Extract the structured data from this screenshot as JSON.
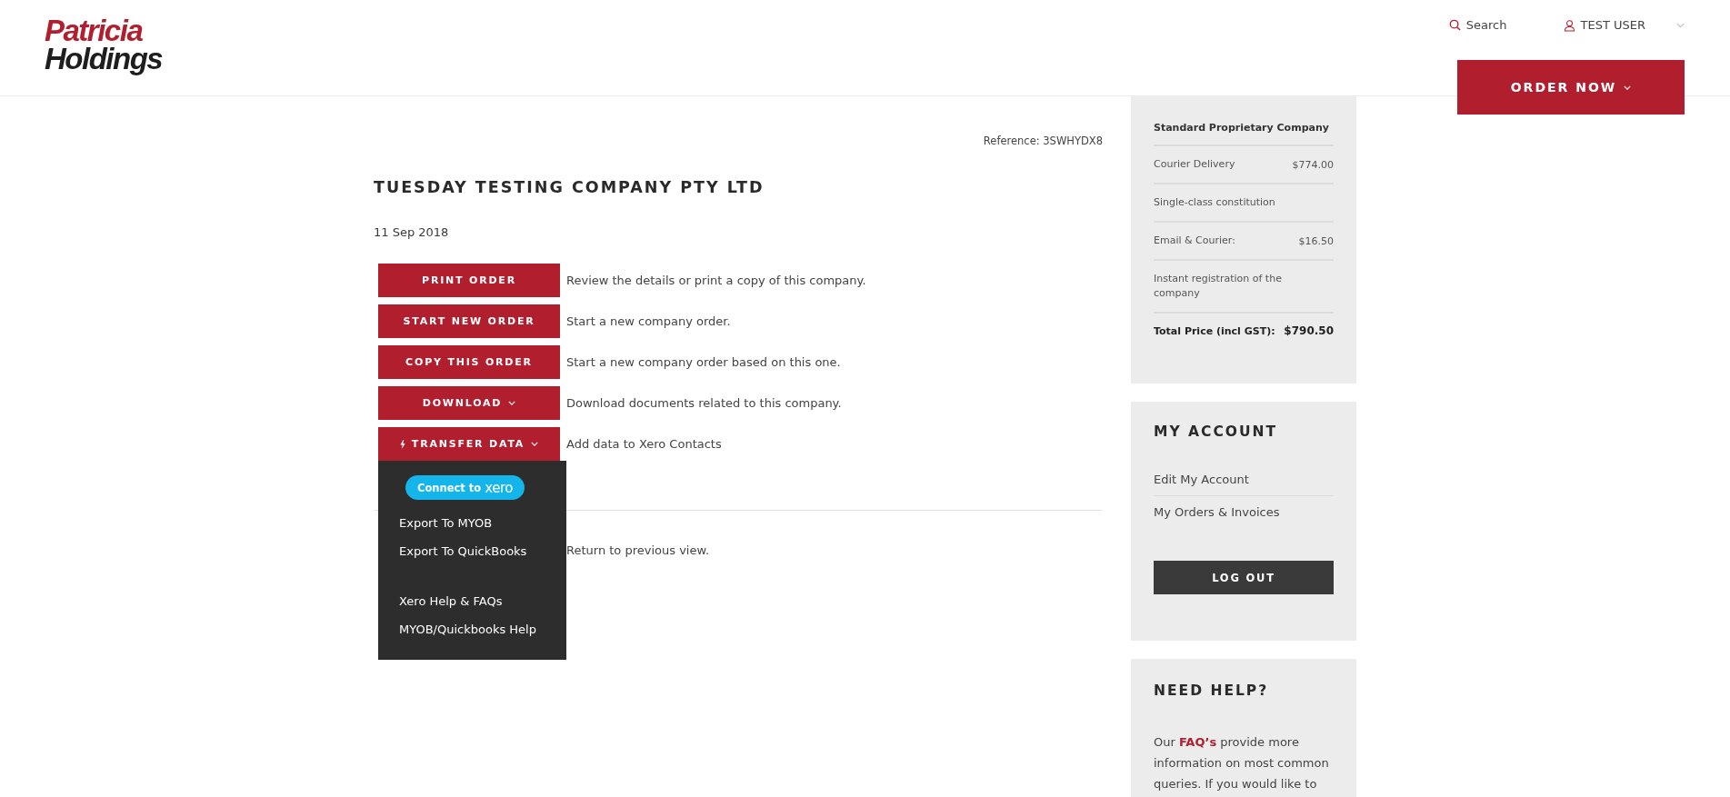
{
  "header": {
    "logo_top": "Patricia",
    "logo_bottom": "Holdings",
    "search": "Search",
    "user": "TEST USER",
    "order_button": "ORDER NOW"
  },
  "order": {
    "reference": "Reference: 3SWHYDX8",
    "company": "TUESDAY TESTING COMPANY PTY LTD",
    "date": "11 Sep 2018",
    "actions": [
      {
        "label": "PRINT ORDER",
        "kind": "plain",
        "description": "Review the details or print a copy of this company."
      },
      {
        "label": "START NEW ORDER",
        "kind": "plain",
        "description": "Start a new company order."
      },
      {
        "label": "COPY THIS ORDER",
        "kind": "plain",
        "description": "Start a new company order based on this one."
      },
      {
        "label": "DOWNLOAD",
        "kind": "dropdown",
        "description": "Download documents related to this company."
      },
      {
        "label": "TRANSFER DATA",
        "kind": "transfer",
        "description": "Add data to Xero Contacts",
        "expanded": true
      }
    ],
    "transfer_menu": {
      "connect_label": "Connect to",
      "connect_brand": "xero",
      "items": [
        "Export To MYOB",
        "Export To QuickBooks"
      ],
      "help_items": [
        "Xero Help & FAQs",
        "MYOB/Quickbooks Help"
      ]
    },
    "return_text": "Return to previous view."
  },
  "summary": {
    "title": "Standard Proprietary Company",
    "lines": [
      {
        "label": "Courier Delivery",
        "price": "$774.00"
      },
      {
        "label": "Single-class constitution"
      },
      {
        "label": "Email & Courier:",
        "price": "$16.50"
      },
      {
        "label": "Instant registration of the company"
      }
    ],
    "total_label": "Total Price (incl GST):",
    "total_price": "$790.50"
  },
  "account": {
    "title": "MY ACCOUNT",
    "links": [
      "Edit My Account",
      "My Orders & Invoices"
    ],
    "logout": "LOG OUT"
  },
  "help": {
    "title": "NEED HELP?",
    "before": "Our",
    "link": "FAQ’s",
    "after": "provide more information on most common queries. If you would like to"
  }
}
